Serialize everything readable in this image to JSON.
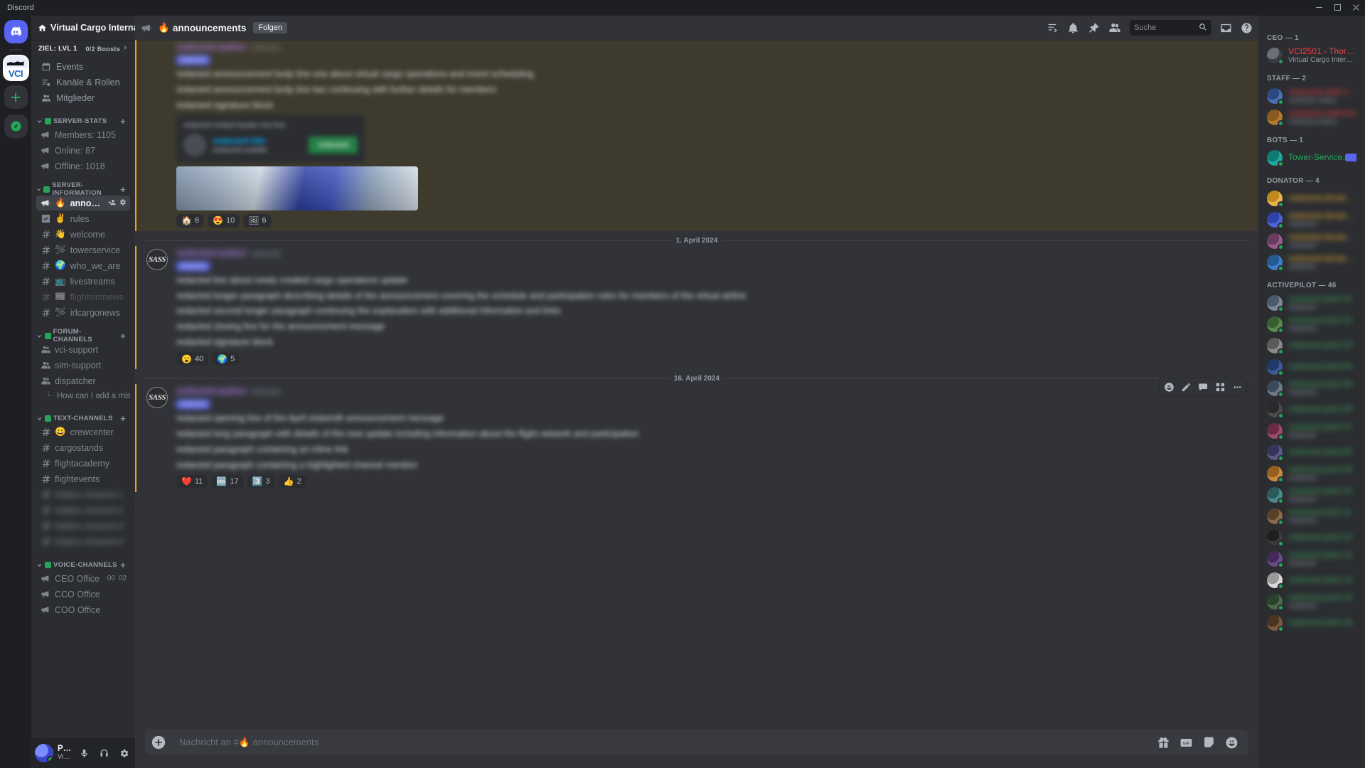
{
  "window": {
    "title": "Discord"
  },
  "rail": {
    "home_tooltip": "Startseite",
    "server_initials": "VCI",
    "add_server": "+",
    "explore": "Server entdecken"
  },
  "sidebar": {
    "server_name": "Virtual Cargo Interna...",
    "boost": {
      "goal_label": "ZIEL: LVL 1",
      "count_label": "0/2 Boosts"
    },
    "nav": [
      {
        "label": "Events",
        "icon": "calendar-icon"
      },
      {
        "label": "Kanäle & Rollen",
        "icon": "channels-roles-icon"
      },
      {
        "label": "Mitglieder",
        "icon": "members-icon"
      }
    ],
    "categories": [
      {
        "name": "SERVER-STATS",
        "channels": [
          {
            "emoji": "",
            "name": "Members: 1105",
            "type": "voice",
            "state": "normal"
          },
          {
            "emoji": "",
            "name": "Online: 87",
            "type": "voice",
            "state": "normal"
          },
          {
            "emoji": "",
            "name": "Offline: 1018",
            "type": "voice",
            "state": "normal"
          }
        ]
      },
      {
        "name": "SERVER-INFORMATION",
        "channels": [
          {
            "emoji": "🔥",
            "name": "announcements",
            "type": "announcement",
            "state": "active"
          },
          {
            "emoji": "✌️",
            "name": "rules",
            "type": "rules",
            "state": "normal"
          },
          {
            "emoji": "👋",
            "name": "welcome",
            "type": "text",
            "state": "normal"
          },
          {
            "emoji": "🛩",
            "name": "towerservice",
            "type": "text",
            "state": "normal"
          },
          {
            "emoji": "🌍",
            "name": "who_we_are",
            "type": "text",
            "state": "normal"
          },
          {
            "emoji": "📺",
            "name": "livestreams",
            "type": "text",
            "state": "normal"
          },
          {
            "emoji": "📰",
            "name": "flightsimnews",
            "type": "text",
            "state": "muted"
          },
          {
            "emoji": "🛩",
            "name": "irlcargonews",
            "type": "text",
            "state": "normal"
          }
        ]
      },
      {
        "name": "FORUM-CHANNELS",
        "channels": [
          {
            "emoji": "",
            "name": "vci-support",
            "type": "forum",
            "state": "normal"
          },
          {
            "emoji": "",
            "name": "sim-support",
            "type": "forum",
            "state": "normal"
          },
          {
            "emoji": "",
            "name": "dispatcher",
            "type": "forum",
            "state": "normal"
          }
        ],
        "thread": "How can I add a missing ..."
      },
      {
        "name": "TEXT-CHANNELS",
        "channels": [
          {
            "emoji": "😀",
            "name": "crewcenter",
            "type": "text",
            "state": "normal"
          },
          {
            "emoji": "",
            "name": "cargostands",
            "type": "text",
            "state": "normal"
          },
          {
            "emoji": "",
            "name": "flightacademy",
            "type": "text",
            "state": "normal"
          },
          {
            "emoji": "",
            "name": "flightevents",
            "type": "text",
            "state": "normal"
          },
          {
            "emoji": "",
            "name": "hidden-channel-1",
            "type": "text",
            "state": "blurred"
          },
          {
            "emoji": "",
            "name": "hidden-channel-2",
            "type": "text",
            "state": "blurred"
          },
          {
            "emoji": "",
            "name": "hidden-channel-3",
            "type": "text",
            "state": "blurred"
          },
          {
            "emoji": "",
            "name": "hidden-channel-4",
            "type": "text",
            "state": "blurred"
          }
        ]
      },
      {
        "name": "VOICE-CHANNELS",
        "channels": [
          {
            "emoji": "",
            "name": "CEO Office",
            "type": "voice",
            "state": "normal",
            "meta_left": "00",
            "meta_right": "02"
          },
          {
            "emoji": "",
            "name": "CCO Office",
            "type": "voice",
            "state": "normal"
          },
          {
            "emoji": "",
            "name": "COO Office",
            "type": "voice",
            "state": "normal"
          }
        ]
      }
    ],
    "user_panel": {
      "username": "PaintSplas...",
      "subtitle": "Virtual Cargo...",
      "mic_icon": "microphone-icon",
      "headset_icon": "headset-icon",
      "settings_icon": "gear-icon"
    }
  },
  "chat_header": {
    "channel_emoji": "🔥",
    "channel_name": "announcements",
    "follow_label": "Folgen",
    "icons": [
      "threads-icon",
      "bell-icon",
      "pin-icon",
      "members-icon"
    ],
    "search_placeholder": "Suche",
    "search_value": "",
    "inbox_icon": "inbox-icon",
    "help_icon": "help-icon"
  },
  "messages": [
    {
      "id": "msg-top",
      "highlighted": true,
      "blurred": true,
      "author": "redacted-author",
      "timestamp": "redacted",
      "role_tag": "redacted",
      "paragraphs": [
        "redacted announcement body line one about virtual cargo operations and event scheduling",
        "redacted announcement body line two continuing with further details for members",
        "redacted signature block"
      ],
      "embed": {
        "header": "redacted embed header text line",
        "title": "redacted title",
        "subtitle": "redacted subtitle",
        "button_label": "redacted"
      },
      "attachment": {
        "type": "image",
        "alt": "airline-banner-image"
      },
      "reactions": [
        {
          "emoji": "🏠",
          "count": "6"
        },
        {
          "emoji": "😍",
          "count": "10"
        },
        {
          "emoji": "🖼",
          "count": "6"
        }
      ]
    },
    {
      "id": "msg-april-1",
      "date_divider": "1. April 2024",
      "highlighted": false,
      "blurred": true,
      "author": "redacted-author",
      "timestamp": "redacted",
      "role_tag": "redacted",
      "avatar_text": "SASS",
      "paragraphs": [
        "redacted line about newly created cargo operations update",
        "redacted longer paragraph describing details of the announcement covering the schedule and participation rules for members of the virtual airline",
        "redacted second longer paragraph continuing the explanation with additional information and links",
        "redacted closing line for the announcement message",
        "redacted signature block"
      ],
      "reactions": [
        {
          "emoji": "😮",
          "count": "40"
        },
        {
          "emoji": "🌍",
          "count": "5"
        }
      ]
    },
    {
      "id": "msg-april-16",
      "date_divider": "16. April 2024",
      "highlighted": false,
      "blurred": true,
      "author": "redacted-author",
      "timestamp": "redacted",
      "role_tag": "redacted",
      "avatar_text": "SASS",
      "hover_toolbar": [
        "add-reaction-icon",
        "edit-icon",
        "thread-icon",
        "apps-icon",
        "more-icon"
      ],
      "paragraphs": [
        "redacted opening line of the April sixteenth announcement message",
        "redacted long paragraph with details of the new update including information about the flight network and participation",
        "redacted paragraph containing an inline link",
        "redacted paragraph containing a highlighted channel mention"
      ],
      "reactions": [
        {
          "emoji": "❤️",
          "count": "11"
        },
        {
          "emoji": "🆒",
          "count": "17"
        },
        {
          "emoji": "3️⃣",
          "count": "3"
        },
        {
          "emoji": "👍",
          "count": "2"
        }
      ]
    }
  ],
  "composer": {
    "placeholder": "Nachricht an #",
    "channel_emoji": "🔥",
    "channel_name": "announcements",
    "icons": [
      "gift-icon",
      "gif-icon",
      "sticker-icon",
      "emoji-icon"
    ]
  },
  "members": {
    "groups": [
      {
        "title": "CEO — 1",
        "members": [
          {
            "name": "VCI2501 - Thorsten",
            "status_text": "Virtual Cargo International",
            "name_color": "#f23f43",
            "presence": "#23a55a",
            "av1": "#3a3d44",
            "av2": "#6a6f78",
            "blurred": false,
            "bot": false
          }
        ]
      },
      {
        "title": "STAFF — 2",
        "members": [
          {
            "name": "redacted-staff-one",
            "status_text": "redacted status",
            "name_color": "#f23f43",
            "presence": "#23a55a",
            "av1": "#4a6fb5",
            "av2": "#2d4a80",
            "blurred": true,
            "bot": false
          },
          {
            "name": "redacted-staff-two",
            "status_text": "redacted status",
            "name_color": "#f23f43",
            "presence": "#23a55a",
            "av1": "#b5792d",
            "av2": "#8a5a20",
            "blurred": true,
            "bot": false
          }
        ]
      },
      {
        "title": "BOTS — 1",
        "members": [
          {
            "name": "Tower-Service",
            "status_text": "",
            "name_color": "#23a55a",
            "presence": "#23a55a",
            "av1": "#1ea8a0",
            "av2": "#0f7a74",
            "blurred": false,
            "bot": true,
            "bot_tag": "APP"
          }
        ]
      },
      {
        "title": "DONATOR — 4",
        "members": [
          {
            "name": "redacted-donator-one",
            "status_text": "",
            "name_color": "#f0b232",
            "presence": "#23a55a",
            "av1": "#e8b44a",
            "av2": "#c08a20",
            "blurred": true,
            "bot": false
          },
          {
            "name": "redacted-donator-two",
            "status_text": "redacted",
            "name_color": "#f0b232",
            "presence": "#23a55a",
            "av1": "#4a63d8",
            "av2": "#2f42a8",
            "blurred": true,
            "bot": false
          },
          {
            "name": "redacted-donator-three",
            "status_text": "redacted",
            "name_color": "#f0b232",
            "presence": "#23a55a",
            "av1": "#9a5a8a",
            "av2": "#6a3a60",
            "blurred": true,
            "bot": false
          },
          {
            "name": "redacted-donator-four",
            "status_text": "redacted",
            "name_color": "#f0b232",
            "presence": "#23a55a",
            "av1": "#3a7fc8",
            "av2": "#245a94",
            "blurred": true,
            "bot": false
          }
        ]
      },
      {
        "title": "ACTIVEPILOT — 46",
        "members": [
          {
            "name": "redacted-pilot-01",
            "status_text": "redacted",
            "name_color": "#3ba55d",
            "presence": "#23a55a",
            "av1": "#7a8a9a",
            "av2": "#4a5a6a",
            "blurred": true,
            "bot": false
          },
          {
            "name": "redacted-pilot-02",
            "status_text": "redacted",
            "name_color": "#3ba55d",
            "presence": "#23a55a",
            "av1": "#5a8a4a",
            "av2": "#3a6030",
            "blurred": true,
            "bot": false
          },
          {
            "name": "redacted-pilot-03",
            "status_text": "",
            "name_color": "#3ba55d",
            "presence": "#23a55a",
            "av1": "#8a8a8a",
            "av2": "#5a5a5a",
            "blurred": true,
            "bot": false
          },
          {
            "name": "redacted-pilot-04",
            "status_text": "",
            "name_color": "#3ba55d",
            "presence": "#23a55a",
            "av1": "#3a5a9a",
            "av2": "#223a6a",
            "blurred": true,
            "bot": false
          },
          {
            "name": "redacted-pilot-05",
            "status_text": "redacted",
            "name_color": "#3ba55d",
            "presence": "#23a55a",
            "av1": "#6a7a8a",
            "av2": "#3a4a5a",
            "blurred": true,
            "bot": false
          },
          {
            "name": "redacted-pilot-06",
            "status_text": "",
            "name_color": "#3ba55d",
            "presence": "#23a55a",
            "av1": "#4a4a4a",
            "av2": "#2a2a2a",
            "blurred": true,
            "bot": false
          },
          {
            "name": "redacted-pilot-07",
            "status_text": "redacted",
            "name_color": "#3ba55d",
            "presence": "#23a55a",
            "av1": "#9a4a6a",
            "av2": "#6a2a44",
            "blurred": true,
            "bot": false
          },
          {
            "name": "redacted-pilot-08",
            "status_text": "",
            "name_color": "#3ba55d",
            "presence": "#23a55a",
            "av1": "#5a5a8a",
            "av2": "#35355a",
            "blurred": true,
            "bot": false
          },
          {
            "name": "redacted-pilot-09",
            "status_text": "redacted",
            "name_color": "#3ba55d",
            "presence": "#23a55a",
            "av1": "#c88a3a",
            "av2": "#945f20",
            "blurred": true,
            "bot": false
          },
          {
            "name": "redacted-pilot-10",
            "status_text": "redacted",
            "name_color": "#3ba55d",
            "presence": "#23a55a",
            "av1": "#4a8a8a",
            "av2": "#2a5a5a",
            "blurred": true,
            "bot": false
          },
          {
            "name": "redacted-pilot-11",
            "status_text": "redacted",
            "name_color": "#3ba55d",
            "presence": "#23a55a",
            "av1": "#8a6a4a",
            "av2": "#5a422a",
            "blurred": true,
            "bot": false
          },
          {
            "name": "redacted-pilot-12",
            "status_text": "",
            "name_color": "#3ba55d",
            "presence": "#23a55a",
            "av1": "#3a3a3a",
            "av2": "#1f1f1f",
            "blurred": true,
            "bot": false
          },
          {
            "name": "redacted-pilot-13",
            "status_text": "redacted",
            "name_color": "#3ba55d",
            "presence": "#23a55a",
            "av1": "#6a4a8a",
            "av2": "#42295a",
            "blurred": true,
            "bot": false
          },
          {
            "name": "redacted-pilot-14",
            "status_text": "",
            "name_color": "#3ba55d",
            "presence": "#23a55a",
            "av1": "#d8d8d8",
            "av2": "#9a9a9a",
            "blurred": true,
            "bot": false
          },
          {
            "name": "redacted-pilot-15",
            "status_text": "redacted",
            "name_color": "#3ba55d",
            "presence": "#23a55a",
            "av1": "#4a6a4a",
            "av2": "#2a422a",
            "blurred": true,
            "bot": false
          },
          {
            "name": "redacted-pilot-16",
            "status_text": "",
            "name_color": "#3ba55d",
            "presence": "#23a55a",
            "av1": "#7a5a3a",
            "av2": "#4a3520",
            "blurred": true,
            "bot": false
          }
        ]
      }
    ]
  }
}
